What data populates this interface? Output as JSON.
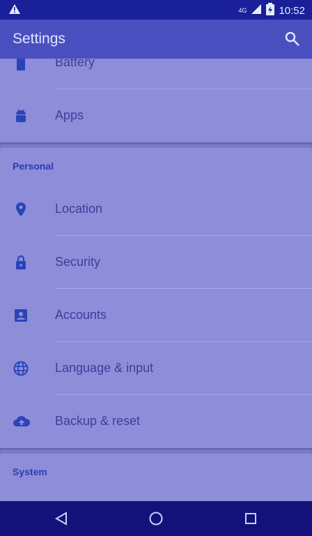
{
  "status": {
    "network": "4G",
    "time": "10:52"
  },
  "app_bar": {
    "title": "Settings"
  },
  "sections": {
    "device_tail": {
      "items": [
        {
          "label": "Battery"
        },
        {
          "label": "Apps"
        }
      ]
    },
    "personal": {
      "header": "Personal",
      "items": [
        {
          "label": "Location",
          "icon": "location-icon"
        },
        {
          "label": "Security",
          "icon": "lock-icon"
        },
        {
          "label": "Accounts",
          "icon": "account-icon"
        },
        {
          "label": "Language & input",
          "icon": "globe-icon"
        },
        {
          "label": "Backup & reset",
          "icon": "cloud-upload-icon"
        }
      ]
    },
    "system": {
      "header": "System"
    }
  },
  "colors": {
    "accent": "#2f3ab0",
    "app_bar": "#4a4fc0",
    "icon": "#2a44b8"
  }
}
